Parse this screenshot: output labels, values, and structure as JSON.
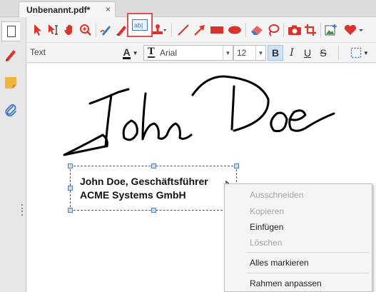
{
  "tab": {
    "title": "Unbenannt.pdf*",
    "close_glyph": "×"
  },
  "sidebar": {
    "items": [
      {
        "name": "pages",
        "icon": "page-icon"
      },
      {
        "name": "signatures",
        "icon": "pen-icon"
      },
      {
        "name": "notes",
        "icon": "note-icon"
      },
      {
        "name": "attachments",
        "icon": "paperclip-icon"
      }
    ]
  },
  "toolbar": {
    "tools": [
      "select-arrow",
      "select-text",
      "hand",
      "zoom",
      "pen",
      "highlighter",
      "textbox",
      "stamp",
      "line",
      "arrow",
      "rectangle",
      "ellipse",
      "eraser",
      "lasso",
      "snapshot",
      "crop",
      "insert-image",
      "heart"
    ],
    "textbox_label": "ab|",
    "accent": "#d9342b",
    "highlight_border": "#e05050"
  },
  "format_bar": {
    "label": "Text",
    "color_letter": "A",
    "font_icon_letter": "T",
    "font": "Arial",
    "size": "12",
    "bold": "B",
    "italic": "I",
    "underline": "U",
    "strike": "S"
  },
  "document": {
    "signature_name": "John Doe",
    "text_line1": "John Doe, Geschäftsführer",
    "text_line2": "ACME Systems GmbH"
  },
  "context_menu": {
    "items": [
      {
        "label": "Ausschneiden",
        "enabled": false
      },
      {
        "label": "Kopieren",
        "enabled": false
      },
      {
        "label": "Einfügen",
        "enabled": true
      },
      {
        "label": "Löschen",
        "enabled": false
      },
      {
        "label": "Alles markieren",
        "enabled": true
      },
      {
        "label": "Rahmen anpassen",
        "enabled": true
      }
    ]
  }
}
